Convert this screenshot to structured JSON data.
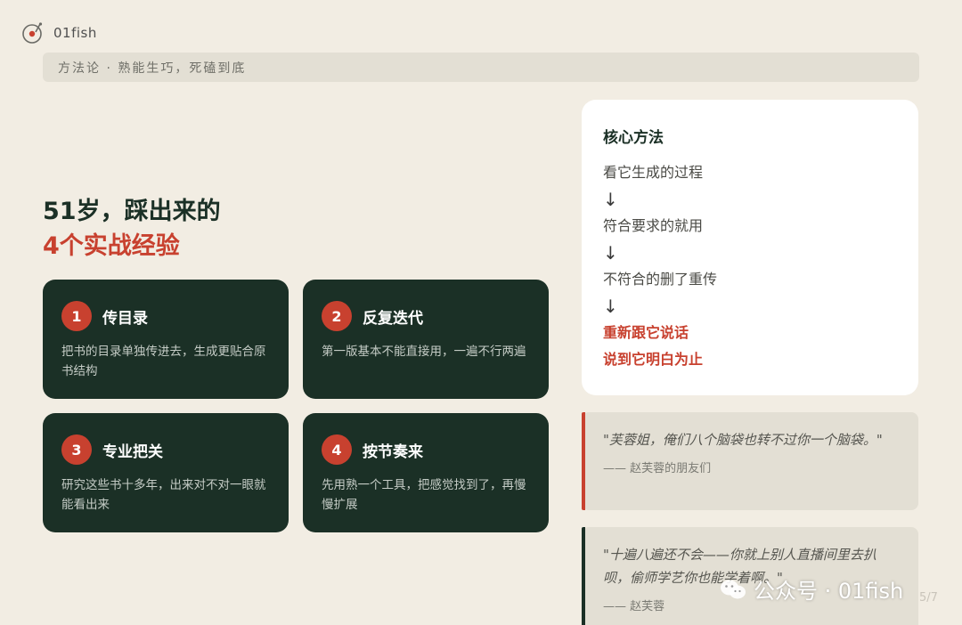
{
  "brand": {
    "name": "01fish",
    "icon": "turntable-icon"
  },
  "subtitle": "方法论 · 熟能生巧，死磕到底",
  "headline": {
    "line1": "51岁，踩出来的",
    "line2": "4个实战经验"
  },
  "cards": [
    {
      "num": "1",
      "title": "传目录",
      "desc": "把书的目录单独传进去，生成更贴合原书结构"
    },
    {
      "num": "2",
      "title": "反复迭代",
      "desc": "第一版基本不能直接用，一遍不行两遍"
    },
    {
      "num": "3",
      "title": "专业把关",
      "desc": "研究这些书十多年，出来对不对一眼就能看出来"
    },
    {
      "num": "4",
      "title": "按节奏来",
      "desc": "先用熟一个工具，把感觉找到了，再慢慢扩展"
    }
  ],
  "method": {
    "title": "核心方法",
    "steps": [
      "看它生成的过程",
      "符合要求的就用",
      "不符合的删了重传"
    ],
    "arrow": "↓",
    "emphasis": [
      "重新跟它说话",
      "说到它明白为止"
    ]
  },
  "quotes": [
    {
      "text": "\"芙蓉姐，俺们八个脑袋也转不过你一个脑袋。\"",
      "author": "—— 赵芙蓉的朋友们"
    },
    {
      "text": "\"十遍八遍还不会——你就上别人直播间里去扒呗，偷师学艺你也能学着啊。\"",
      "author": "—— 赵芙蓉"
    }
  ],
  "watermark": "公众号 · 01fish",
  "page": "5/7",
  "colors": {
    "background": "#f2ede3",
    "dark_green": "#1b3026",
    "accent_red": "#c8412f"
  }
}
